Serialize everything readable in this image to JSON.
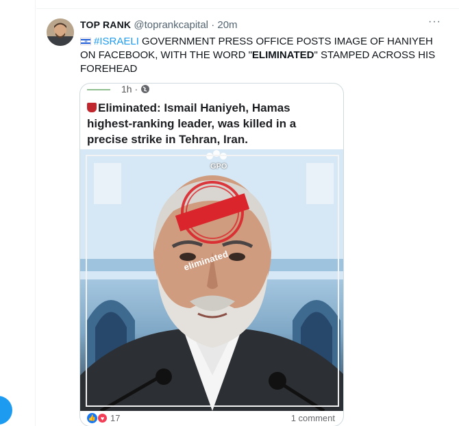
{
  "tweet": {
    "author_name": "TOP RANK",
    "handle": "@toprankcapital",
    "separator": "·",
    "time": "20m",
    "more_label": "···",
    "flag_icon": "israel-flag-icon",
    "hashtag": "#ISRAELI",
    "text_part1": " GOVERNMENT PRESS OFFICE POSTS IMAGE OF HANIYEH ON FACEBOOK, WITH THE WORD \"",
    "text_bold": "ELIMINATED",
    "text_part2": "\" STAMPED ACROSS HIS FOREHEAD"
  },
  "card": {
    "post_time": "1h ·",
    "post_text": "Eliminated: Ismail Haniyeh, Hamas highest-ranking leader, was killed in a precise strike in Tehran, Iran.",
    "watermark": "GPO",
    "stamp_word": "eliminated",
    "reaction_count": "17",
    "comments": "1 comment"
  },
  "colors": {
    "accent": "#1d9bf0",
    "stamp_red": "#d9252b",
    "like_blue": "#1877f2",
    "love_red": "#f33e58"
  }
}
